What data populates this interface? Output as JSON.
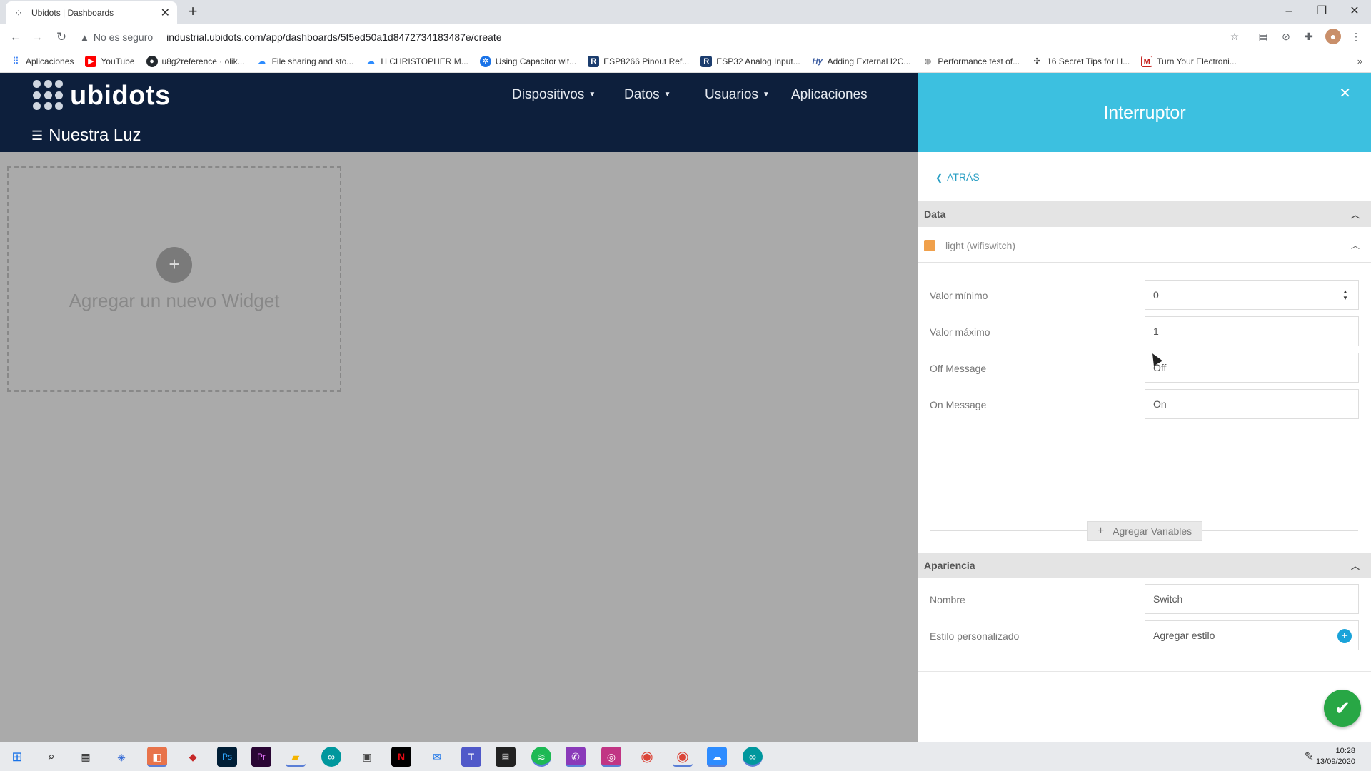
{
  "browser": {
    "tab_title": "Ubidots | Dashboards",
    "security_label": "No es seguro",
    "url": "industrial.ubidots.com/app/dashboards/5f5ed50a1d8472734183487e/create",
    "bookmarks": [
      {
        "label": "Aplicaciones",
        "icon": "apps-grid-icon",
        "color": "#4285f4"
      },
      {
        "label": "YouTube",
        "icon": "youtube-icon",
        "color": "#ff0000"
      },
      {
        "label": "u8g2reference · olik...",
        "icon": "github-icon",
        "color": "#24292e"
      },
      {
        "label": "File sharing and sto...",
        "icon": "cloud-icon",
        "color": "#2d8cff"
      },
      {
        "label": "H CHRISTOPHER M...",
        "icon": "cloud-icon",
        "color": "#2d8cff"
      },
      {
        "label": "Using Capacitor wit...",
        "icon": "chip-icon",
        "color": "#1a73e8"
      },
      {
        "label": "ESP8266 Pinout Ref...",
        "icon": "r-icon",
        "color": "#1c3d6e"
      },
      {
        "label": "ESP32 Analog Input...",
        "icon": "r-icon",
        "color": "#1c3d6e"
      },
      {
        "label": "Adding External I2C...",
        "icon": "hy-icon",
        "color": "#3a5ba0"
      },
      {
        "label": "Performance test of...",
        "icon": "globe-icon",
        "color": "#666666"
      },
      {
        "label": "16 Secret Tips for H...",
        "icon": "tips-icon",
        "color": "#444444"
      },
      {
        "label": "Turn Your Electroni...",
        "icon": "mail-m-icon",
        "color": "#c5221f"
      }
    ]
  },
  "app": {
    "brand": "ubidots",
    "nav": [
      {
        "label": "Dispositivos",
        "has_caret": true
      },
      {
        "label": "Datos",
        "has_caret": true
      },
      {
        "label": "Usuarios",
        "has_caret": true
      },
      {
        "label": "Aplicaciones",
        "has_caret": false
      }
    ],
    "dashboard_name": "Nuestra Luz",
    "add_widget_label": "Agregar un nuevo Widget"
  },
  "panel": {
    "title": "Interruptor",
    "back_label": "ATRÁS",
    "data_section": "Data",
    "variable_label": "light (wifiswitch)",
    "variable_color": "#f0a04b",
    "fields": [
      {
        "label": "Valor mínimo",
        "value": "0"
      },
      {
        "label": "Valor máximo",
        "value": "1"
      },
      {
        "label": "Off Message",
        "value": "Off"
      },
      {
        "label": "On Message",
        "value": "On"
      }
    ],
    "add_variables_label": "Agregar Variables",
    "appearance_section": "Apariencia",
    "name_label": "Nombre",
    "name_value": "Switch",
    "style_label": "Estilo personalizado",
    "style_value": "Agregar estilo"
  },
  "taskbar": {
    "time": "10:28",
    "date": "13/09/2020"
  }
}
